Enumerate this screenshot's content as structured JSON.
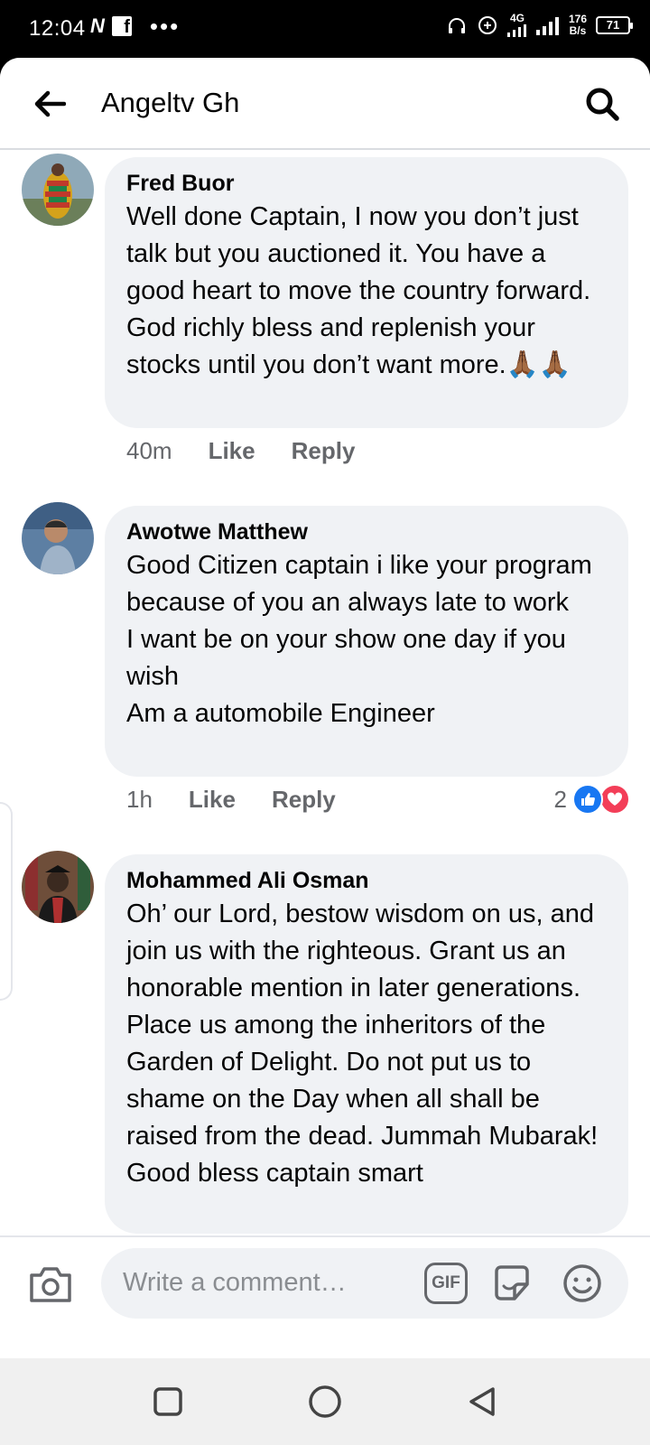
{
  "status_bar": {
    "time": "12:04",
    "network_icon": "N",
    "fb_icon": "f",
    "more_dots": "•••",
    "net_type": "4G",
    "speed_value": "176",
    "speed_unit": "B/s",
    "battery": "71"
  },
  "header": {
    "title": "Angeltv Gh",
    "back_icon": "arrow-left-icon",
    "search_icon": "search-icon"
  },
  "comments": [
    {
      "author": "Fred Buor",
      "text": "Well done Captain, I now you don’t just talk but you auctioned it. You have a good heart to move the country forward. God richly bless and replenish your stocks until you don’t want more.🙏🏾🙏🏾",
      "time": "40m",
      "like": "Like",
      "reply": "Reply"
    },
    {
      "author": "Awotwe Matthew",
      "text": "Good Citizen captain i like your program because of you an always late to work\nI want be on your show one day if you wish\nAm a automobile Engineer",
      "time": "1h",
      "like": "Like",
      "reply": "Reply",
      "reaction_count": "2",
      "reactions": [
        "like-icon",
        "love-icon"
      ]
    },
    {
      "author": "Mohammed Ali Osman",
      "text": "Oh’ our Lord, bestow wisdom on us, and join us with the righteous. Grant us an honorable mention in later generations. Place us among the inheritors of the Garden of Delight. Do not put us to shame on the Day when all shall be raised from the dead. Jummah Mubarak! Good bless captain smart"
    }
  ],
  "composer": {
    "placeholder": "Write a comment…",
    "gif_label": "GIF",
    "camera_icon": "camera-icon",
    "sticker_icon": "sticker-icon",
    "emoji_icon": "emoji-icon"
  },
  "navbar": {
    "recents_icon": "square-icon",
    "home_icon": "circle-icon",
    "back_icon": "triangle-back-icon"
  },
  "colors": {
    "bubble": "#f0f2f5",
    "text": "#050505",
    "secondary": "#65676b",
    "like_blue": "#1877f2",
    "love_red": "#f33e58"
  }
}
